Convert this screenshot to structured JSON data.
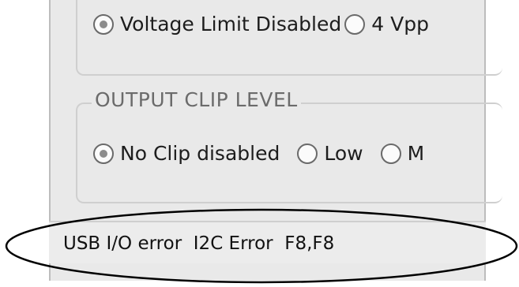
{
  "voltage_group": {
    "options": [
      {
        "label": "Voltage Limit Disabled",
        "checked": true
      },
      {
        "label": "4 Vpp",
        "checked": false
      }
    ]
  },
  "clip_group": {
    "title": "OUTPUT CLIP LEVEL",
    "options": [
      {
        "label": "No Clip disabled",
        "checked": true
      },
      {
        "label": "Low",
        "checked": false
      },
      {
        "label": "M",
        "checked": false
      }
    ]
  },
  "status": {
    "text": "USB I/O error  I2C Error  F8,F8"
  },
  "colors": {
    "panel_bg": "#e9e9e9",
    "annotation_ellipse": "#000000"
  }
}
